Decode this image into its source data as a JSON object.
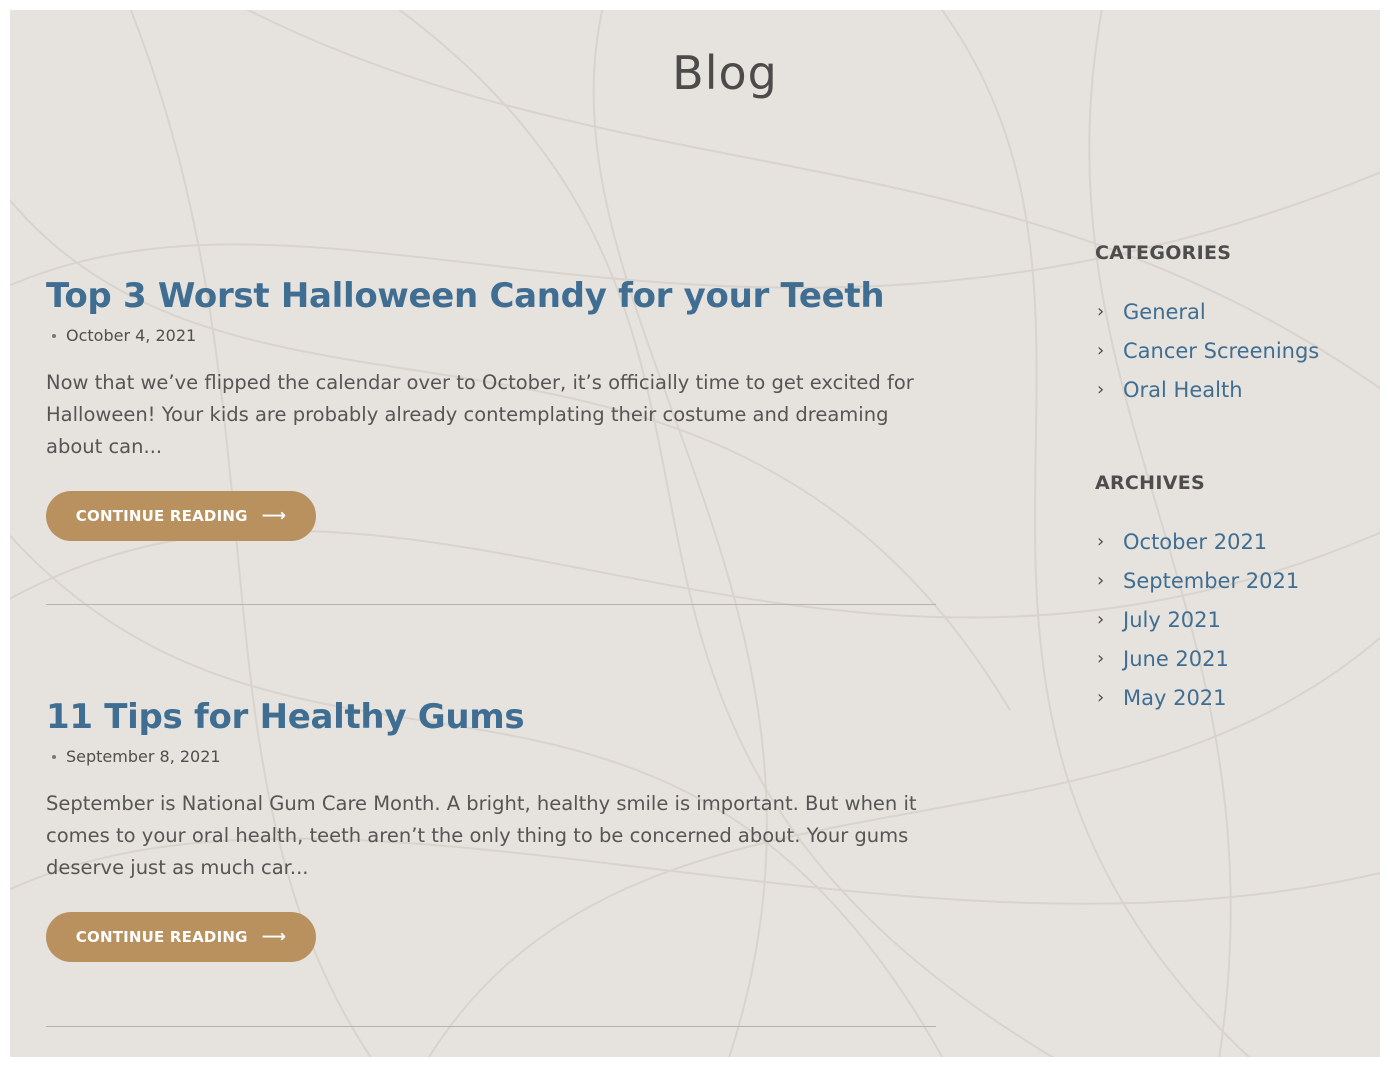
{
  "page": {
    "title": "Blog"
  },
  "posts": [
    {
      "title": "Top 3 Worst Halloween Candy for your Teeth",
      "date": "October 4, 2021",
      "excerpt": "Now that we’ve flipped the calendar over to October, it’s officially time to get excited for Halloween! Your kids are probably already contemplating their costume and dreaming about can...",
      "button_label": "CONTINUE READING",
      "button_icon": "arrow-right-icon"
    },
    {
      "title": "11 Tips for Healthy Gums",
      "date": "September 8, 2021",
      "excerpt": "September is National Gum Care Month. A bright, healthy smile is important. But when it comes to your oral health, teeth aren’t the only thing to be concerned about. Your gums deserve just as much car...",
      "button_label": "CONTINUE READING",
      "button_icon": "arrow-right-icon"
    }
  ],
  "sidebar": {
    "categories": {
      "title": "CATEGORIES",
      "items": [
        "General",
        "Cancer Screenings",
        "Oral Health"
      ]
    },
    "archives": {
      "title": "ARCHIVES",
      "items": [
        "October 2021",
        "September 2021",
        "July 2021",
        "June 2021",
        "May 2021"
      ]
    },
    "item_icon": "chevron-right-icon"
  },
  "colors": {
    "background": "#e6e2dd",
    "link": "#3f6e92",
    "button": "#b9915f",
    "heading": "#4b4b4b"
  }
}
